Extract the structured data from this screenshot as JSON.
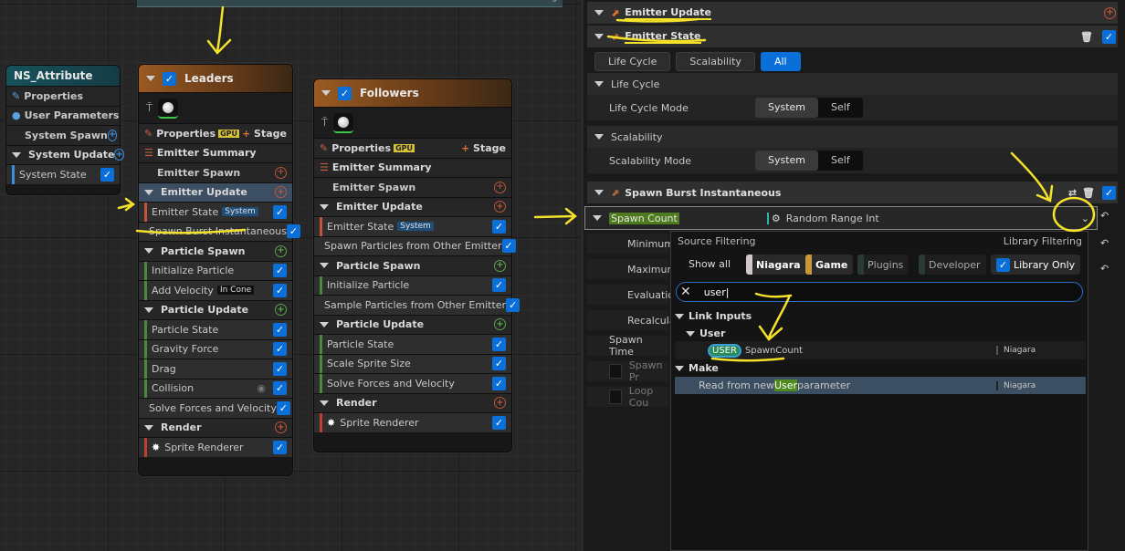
{
  "graph": {
    "topbar_glyph": "»",
    "ns_node": {
      "title": "NS_Attribute",
      "rows": [
        "Properties",
        "User Parameters",
        "System Spawn",
        "System Update",
        "System State"
      ]
    },
    "leaders": {
      "title": "Leaders",
      "properties": "Properties",
      "gpu": "GPU",
      "stage": "Stage",
      "rows": [
        {
          "t": "sec",
          "label": "Emitter Summary",
          "icon": "list"
        },
        {
          "t": "item",
          "label": "Emitter Spawn",
          "plus": "red",
          "center": true
        },
        {
          "t": "sec",
          "label": "Emitter Update",
          "plus": "red",
          "sel": true
        },
        {
          "t": "item",
          "label": "Emitter State",
          "tag": "System",
          "check": true
        },
        {
          "t": "item",
          "label": "Spawn Burst Instantaneous",
          "check": true
        },
        {
          "t": "sec",
          "label": "Particle Spawn",
          "plus": "green"
        },
        {
          "t": "item",
          "label": "Initialize Particle",
          "check": true
        },
        {
          "t": "item",
          "label": "Add Velocity",
          "tag": "In Cone",
          "tagdark": true,
          "check": true
        },
        {
          "t": "sec",
          "label": "Particle Update",
          "plus": "green"
        },
        {
          "t": "item",
          "label": "Particle State",
          "check": true
        },
        {
          "t": "item",
          "label": "Gravity Force",
          "check": true
        },
        {
          "t": "item",
          "label": "Drag",
          "check": true
        },
        {
          "t": "item",
          "label": "Collision",
          "eye": true,
          "check": true
        },
        {
          "t": "item",
          "label": "Solve Forces and Velocity",
          "check": true
        },
        {
          "t": "sec",
          "label": "Render",
          "plus": "red"
        },
        {
          "t": "item",
          "label": "Sprite Renderer",
          "sprite": true,
          "check": true
        }
      ]
    },
    "followers": {
      "title": "Followers",
      "properties": "Properties",
      "gpu": "GPU",
      "stage": "Stage",
      "rows": [
        {
          "t": "sec",
          "label": "Emitter Summary",
          "icon": "list"
        },
        {
          "t": "item",
          "label": "Emitter Spawn",
          "plus": "red",
          "center": true
        },
        {
          "t": "sec",
          "label": "Emitter Update",
          "plus": "red"
        },
        {
          "t": "item",
          "label": "Emitter State",
          "tag": "System",
          "check": true
        },
        {
          "t": "item",
          "label": "Spawn Particles from Other Emitter",
          "check": true
        },
        {
          "t": "sec",
          "label": "Particle Spawn",
          "plus": "green"
        },
        {
          "t": "item",
          "label": "Initialize Particle",
          "check": true
        },
        {
          "t": "item",
          "label": "Sample Particles from Other Emitter",
          "check": true
        },
        {
          "t": "sec",
          "label": "Particle Update",
          "plus": "green"
        },
        {
          "t": "item",
          "label": "Particle State",
          "check": true
        },
        {
          "t": "item",
          "label": "Scale Sprite Size",
          "check": true
        },
        {
          "t": "item",
          "label": "Solve Forces and Velocity",
          "check": true
        },
        {
          "t": "sec",
          "label": "Render",
          "plus": "red"
        },
        {
          "t": "item",
          "label": "Sprite Renderer",
          "sprite": true,
          "check": true
        }
      ]
    }
  },
  "details": {
    "emitter_update": "Emitter Update",
    "emitter_state": "Emitter State",
    "filters": [
      "Life Cycle",
      "Scalability",
      "All"
    ],
    "life_cycle": "Life Cycle",
    "life_cycle_mode": "Life Cycle Mode",
    "scalability": "Scalability",
    "scalability_mode": "Scalability Mode",
    "mode_options": [
      "System",
      "Self"
    ],
    "spawn_burst": "Spawn Burst Instantaneous",
    "spawn_count": "Spawn Count",
    "random_range": "Random Range Int",
    "props": [
      "Minimum",
      "Maximum",
      "Evaluation",
      "Recalculate",
      "Spawn Time",
      "Spawn Pr",
      "Loop Cou"
    ]
  },
  "popup": {
    "source_filtering": "Source Filtering",
    "library_filtering": "Library Filtering",
    "show_all": "Show all",
    "sources": [
      "Niagara",
      "Game",
      "Plugins",
      "Developer"
    ],
    "library_only": "Library Only",
    "search_value": "user",
    "link_inputs": "Link Inputs",
    "user_group": "User",
    "user_badge": "USER",
    "spawn_count_param": "SpawnCount",
    "niagara": "Niagara",
    "make": "Make",
    "read_pre": "Read from new ",
    "read_hl": "User",
    "read_post": " parameter"
  }
}
